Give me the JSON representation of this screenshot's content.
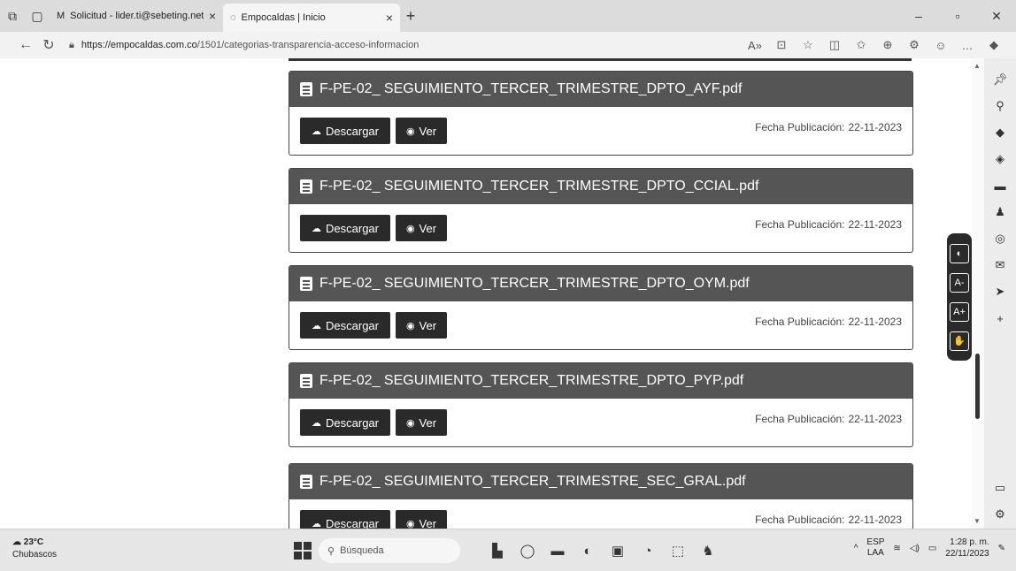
{
  "browser": {
    "tabs": [
      {
        "label": "Solicitud - lider.ti@sebeting.net ·",
        "icon": "mail-icon",
        "active": false
      },
      {
        "label": "Empocaldas | Inicio",
        "icon": "site-icon",
        "active": true
      }
    ],
    "url_domain": "https://empocaldas.com.co",
    "url_path": "/1501/categorias-transparencia-acceso-informacion"
  },
  "documents": [
    {
      "filename": "F-PE-02_ SEGUIMIENTO_TERCER_TRIMESTRE_DPTO_AYF.pdf",
      "download_label": "Descargar",
      "view_label": "Ver",
      "date_label": "Fecha Publicación:",
      "date": "22-11-2023"
    },
    {
      "filename": "F-PE-02_ SEGUIMIENTO_TERCER_TRIMESTRE_DPTO_CCIAL.pdf",
      "download_label": "Descargar",
      "view_label": "Ver",
      "date_label": "Fecha Publicación:",
      "date": "22-11-2023"
    },
    {
      "filename": "F-PE-02_ SEGUIMIENTO_TERCER_TRIMESTRE_DPTO_OYM.pdf",
      "download_label": "Descargar",
      "view_label": "Ver",
      "date_label": "Fecha Publicación:",
      "date": "22-11-2023"
    },
    {
      "filename": "F-PE-02_ SEGUIMIENTO_TERCER_TRIMESTRE_DPTO_PYP.pdf",
      "download_label": "Descargar",
      "view_label": "Ver",
      "date_label": "Fecha Publicación:",
      "date": "22-11-2023"
    },
    {
      "filename": "F-PE-02_ SEGUIMIENTO_TERCER_TRIMESTRE_SEC_GRAL.pdf",
      "download_label": "Descargar",
      "view_label": "Ver",
      "date_label": "Fecha Publicación:",
      "date": "22-11-2023"
    }
  ],
  "accessibility": {
    "contrast": "◐",
    "decrease_text": "A-",
    "increase_text": "A+",
    "sign_language": "✋"
  },
  "taskbar": {
    "weather_temp": "23°C",
    "weather_desc": "Chubascos",
    "search_placeholder": "Búsqueda",
    "lang_top": "ESP",
    "lang_bottom": "LAA",
    "time": "1:28 p. m.",
    "date": "22/11/2023"
  }
}
